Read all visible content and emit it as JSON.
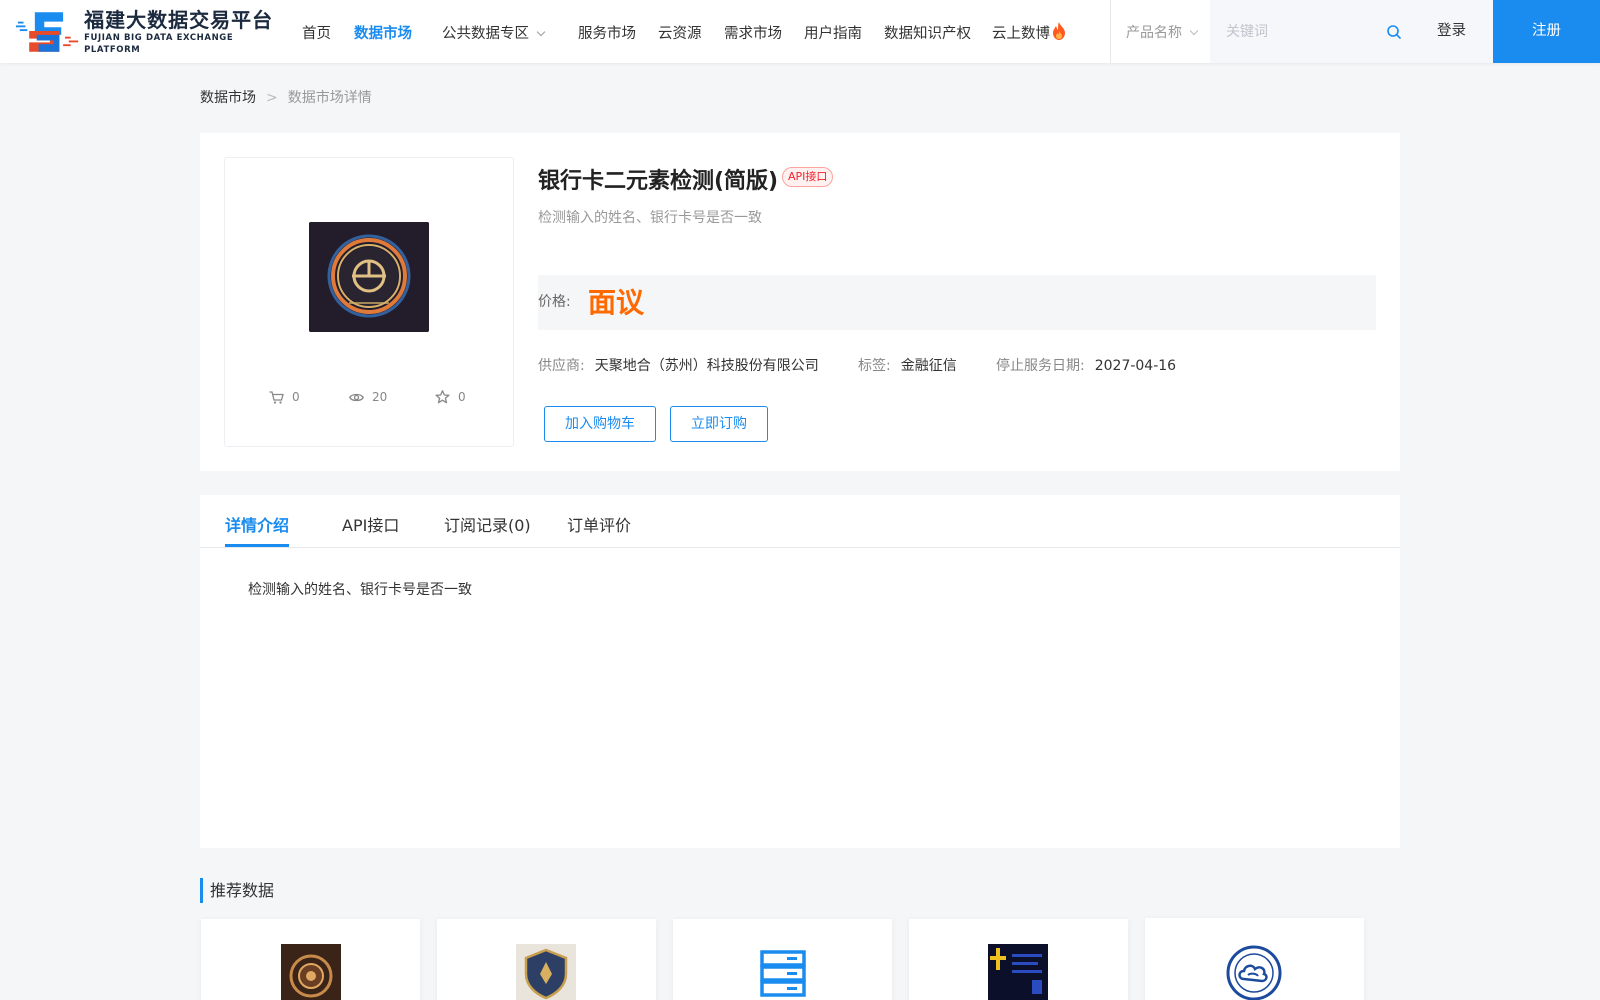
{
  "header": {
    "logo_cn": "福建大数据交易平台",
    "logo_en": "FUJIAN BIG DATA EXCHANGE  PLATFORM",
    "nav": [
      {
        "label": "首页"
      },
      {
        "label": "数据市场",
        "active": true
      },
      {
        "label": "公共数据专区",
        "has_dropdown": true
      },
      {
        "label": "服务市场"
      },
      {
        "label": "云资源"
      },
      {
        "label": "需求市场"
      },
      {
        "label": "用户指南"
      },
      {
        "label": "数据知识产权"
      },
      {
        "label": "云上数博",
        "icon": "fire-icon"
      }
    ],
    "search": {
      "type_label": "产品名称",
      "placeholder": "关键词",
      "value": ""
    },
    "login_label": "登录",
    "register_label": "注册"
  },
  "breadcrumb": {
    "parent": "数据市场",
    "separator": ">",
    "current": "数据市场详情"
  },
  "product": {
    "title": "银行卡二元素检测(简版)",
    "badge": "API接口",
    "description": "检测输入的姓名、银行卡号是否一致",
    "price_label": "价格:",
    "price_value": "面议",
    "supplier_label": "供应商:",
    "supplier": "天聚地合（苏州）科技股份有限公司",
    "tag_label": "标签:",
    "tag": "金融征信",
    "end_date_label": "停止服务日期:",
    "end_date": "2027-04-16",
    "stats": {
      "cart_count": "0",
      "view_count": "20",
      "favorite_count": "0"
    },
    "add_to_cart_label": "加入购物车",
    "subscribe_label": "立即订购"
  },
  "detail": {
    "tabs": [
      {
        "label": "详情介绍",
        "active": true
      },
      {
        "label": "API接口"
      },
      {
        "label": "订阅记录(0)"
      },
      {
        "label": "订单评价"
      }
    ],
    "content": "检测输入的姓名、银行卡号是否一致"
  },
  "recommendations": {
    "title": "推荐数据",
    "items": [
      {
        "thumb_icon": "bronze-emblem-icon"
      },
      {
        "thumb_icon": "shield-emblem-icon"
      },
      {
        "thumb_icon": "server-stack-icon"
      },
      {
        "thumb_icon": "dark-poster-icon"
      },
      {
        "thumb_icon": "cloud-seal-icon"
      }
    ]
  },
  "colors": {
    "accent": "#1a8cf0",
    "price": "#ff6a00",
    "badge": "#f5222d"
  }
}
